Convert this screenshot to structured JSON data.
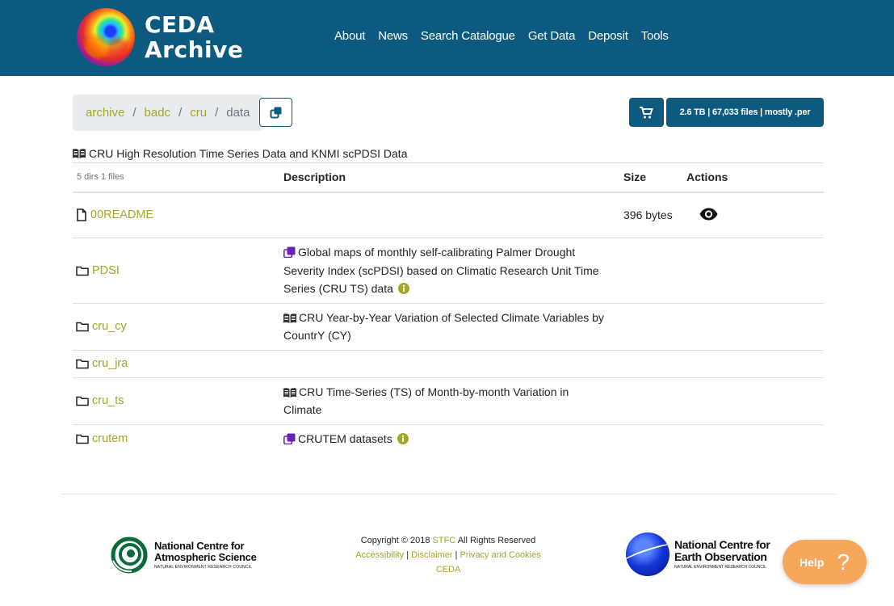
{
  "header": {
    "logo_line1": "CEDA",
    "logo_line2": "Archive",
    "nav": [
      "About",
      "News",
      "Search Catalogue",
      "Get Data",
      "Deposit",
      "Tools"
    ]
  },
  "breadcrumb": {
    "items": [
      "archive",
      "badc",
      "cru"
    ],
    "separator": "/",
    "current": "data"
  },
  "summary": "2.6 TB | 67,033 files | mostly .per",
  "dataset_title": "CRU High Resolution Time Series Data and KNMI scPDSI Data",
  "table": {
    "counts": "5 dirs 1 files",
    "headers": {
      "description": "Description",
      "size": "Size",
      "actions": "Actions"
    },
    "rows": [
      {
        "type": "file",
        "name": "00README",
        "description": "",
        "size": "396 bytes",
        "action": "eye-icon"
      },
      {
        "type": "dir",
        "name": "PDSI",
        "description_icon": "collection-icon",
        "description": "Global maps of monthly self-calibrating Palmer Drought Severity Index (scPDSI) based on Climatic Research Unit Time Series (CRU TS) data",
        "info": true,
        "size": ""
      },
      {
        "type": "dir",
        "name": "cru_cy",
        "description_icon": "book-icon",
        "description": "CRU Year-by-Year Variation of Selected Climate Variables by CountrY (CY)",
        "info": false,
        "size": ""
      },
      {
        "type": "dir",
        "name": "cru_jra",
        "description": "",
        "size": ""
      },
      {
        "type": "dir",
        "name": "cru_ts",
        "description_icon": "book-icon",
        "description": "CRU Time-Series (TS) of Month-by-month Variation in Climate",
        "info": false,
        "size": ""
      },
      {
        "type": "dir",
        "name": "crutem",
        "description_icon": "collection-icon",
        "description": "CRUTEM datasets",
        "info": true,
        "size": ""
      }
    ]
  },
  "footer": {
    "ncas_line1": "National Centre for",
    "ncas_line2": "Atmospheric Science",
    "ncas_line3": "NATURAL ENVIRONMENT RESEARCH COUNCIL",
    "copyright_prefix": "Copyright © 2018",
    "copyright_link": "STFC",
    "copyright_suffix": "All Rights Reserved",
    "links": [
      "Accessibility",
      "Disclaimer",
      "Privacy and Cookies"
    ],
    "link_sep": "|",
    "ceda_link": "CEDA",
    "nceo_line1": "National Centre for",
    "nceo_line2": "Earth Observation",
    "nceo_line3": "NATURAL ENVIRONMENT RESEARCH COUNCIL"
  },
  "help": {
    "label": "Help",
    "glyph": "?"
  },
  "colors": {
    "header": "#0d5a80",
    "link": "#a5a52a",
    "help": "#f7a75c",
    "collection_icon": "#6a1fb5",
    "info_icon": "#a5a52a"
  }
}
